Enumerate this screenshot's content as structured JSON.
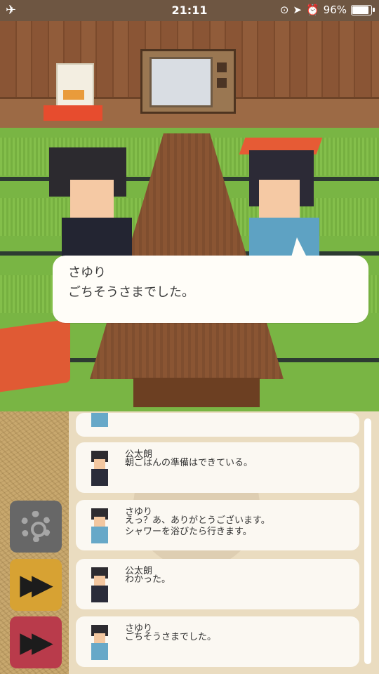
{
  "status_bar": {
    "time": "21:11",
    "battery": "96%",
    "battery_level": 0.96,
    "icons": [
      "airplane-icon",
      "rotation-lock-icon",
      "location-icon",
      "alarm-icon",
      "battery-icon"
    ]
  },
  "dialogue": {
    "speaker": "さゆり",
    "line": "ごちそうさまでした。"
  },
  "log": {
    "entries": [
      {
        "name": "公太朗",
        "text": "朝ごはんの準備はできている。",
        "avatar": "boy-avatar-icon"
      },
      {
        "name": "さゆり",
        "text": "えっ？あ、ありがとうございます。\nシャワーを浴びたら行きます。",
        "avatar": "girl-avatar-icon"
      },
      {
        "name": "公太朗",
        "text": "わかった。",
        "avatar": "boy-avatar-icon"
      },
      {
        "name": "さゆり",
        "text": "ごちそうさまでした。",
        "avatar": "girl-avatar-icon"
      }
    ]
  },
  "controls": {
    "settings_icon": "gear-icon",
    "fast_forward_icon": "fast-forward-icon",
    "skip_icon": "skip-icon"
  },
  "colors": {
    "tatami": "#79b544",
    "wall": "#8a5535",
    "settings_button": "#676767",
    "fast_forward_button": "#d7a233",
    "skip_button": "#b93b4b"
  }
}
